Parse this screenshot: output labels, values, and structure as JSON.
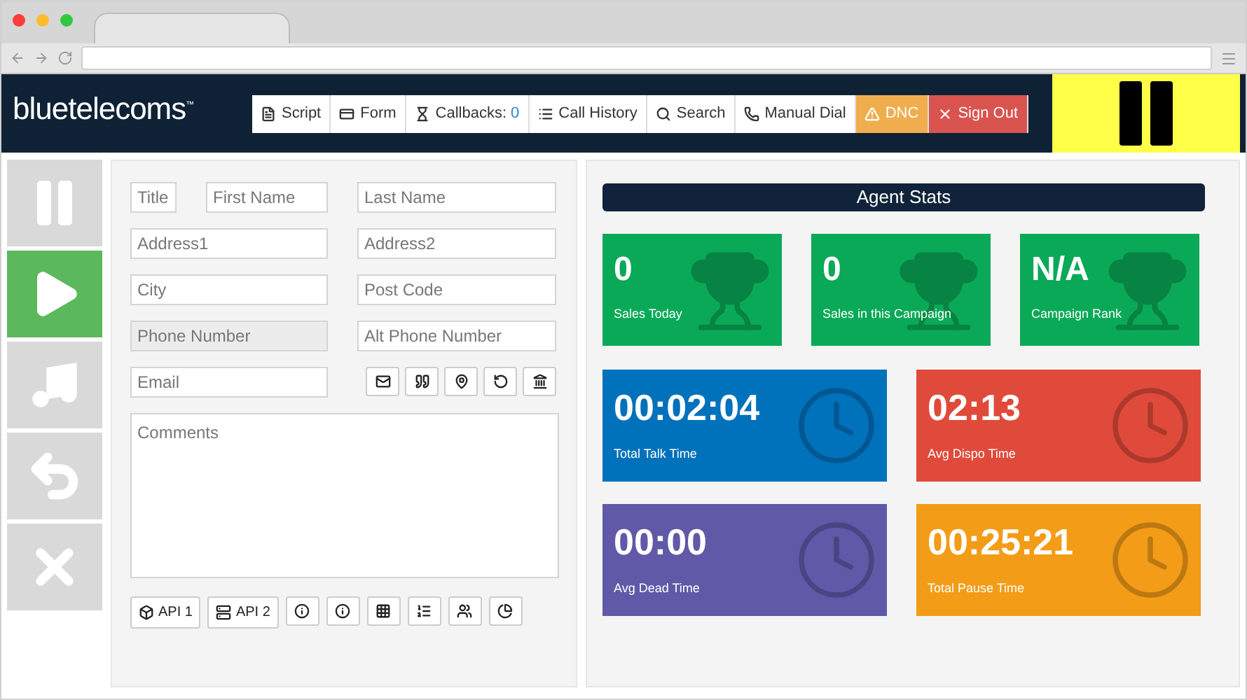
{
  "header": {
    "logo": "bluetelecoms",
    "trademark": "™"
  },
  "nav": [
    {
      "kind": "default",
      "label": "Script"
    },
    {
      "kind": "default",
      "label": "Form"
    },
    {
      "kind": "default",
      "label": "Callbacks:",
      "count": "0"
    },
    {
      "kind": "default",
      "label": "Call History"
    },
    {
      "kind": "default",
      "label": "Search"
    },
    {
      "kind": "default",
      "label": "Manual Dial"
    },
    {
      "kind": "warning",
      "label": "DNC"
    },
    {
      "kind": "danger",
      "label": "Sign Out"
    }
  ],
  "pause_toggle": {
    "on": true
  },
  "sidebar": [
    {
      "active": false
    },
    {
      "active": true
    },
    {
      "active": false
    },
    {
      "active": false
    },
    {
      "active": false
    }
  ],
  "form": {
    "fields": [
      {
        "placeholder": "Title",
        "disabled": false
      },
      {
        "placeholder": "First Name",
        "disabled": false
      },
      {
        "placeholder": "Last Name",
        "disabled": false
      },
      {
        "placeholder": "Address1",
        "disabled": false
      },
      {
        "placeholder": "Address2",
        "disabled": false
      },
      {
        "placeholder": "City",
        "disabled": false
      },
      {
        "placeholder": "Post Code",
        "disabled": false
      },
      {
        "placeholder": "Phone Number",
        "disabled": true
      },
      {
        "placeholder": "Alt Phone Number",
        "disabled": false
      },
      {
        "placeholder": "Email",
        "disabled": false
      }
    ],
    "comments": {
      "placeholder": "Comments"
    },
    "api_buttons": [
      "API 1",
      "API 2"
    ]
  },
  "stats": {
    "title": "Agent Stats",
    "tiles": [
      {
        "kind": "trophy",
        "value": "0",
        "label": "Sales Today",
        "color": "#0aa957"
      },
      {
        "kind": "trophy",
        "value": "0",
        "label": "Sales in this Campaign",
        "color": "#0aa957"
      },
      {
        "kind": "trophy",
        "value": "N/A",
        "label": "Campaign Rank",
        "color": "#0aa957"
      },
      {
        "kind": "clock",
        "value": "00:02:04",
        "label": "Total Talk Time",
        "color": "#0071bb"
      },
      {
        "kind": "clock",
        "value": "02:13",
        "label": "Avg Dispo Time",
        "color": "#df4a3a"
      },
      {
        "kind": "clock",
        "value": "00:00",
        "label": "Avg Dead Time",
        "color": "#5f59a8"
      },
      {
        "kind": "clock",
        "value": "00:25:21",
        "label": "Total Pause Time",
        "color": "#f39c17"
      }
    ]
  }
}
